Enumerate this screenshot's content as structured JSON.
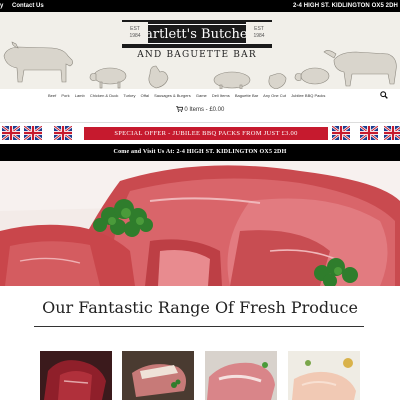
{
  "topbar": {
    "left_text": "y",
    "contact": "Contact Us",
    "address": "2-4 HIGH ST. KIDLINGTON OX5 2DH"
  },
  "logo": {
    "name": "Bartlett's Butchers",
    "subtitle": "AND BAGUETTE BAR",
    "est_label_left": "EST",
    "est_year_left": "1984",
    "est_label_right": "EST",
    "est_year_right": "1984"
  },
  "nav": {
    "items": [
      "Beef",
      "Pork",
      "Lamb",
      "Chicken & Duck",
      "Turkey",
      "Offal",
      "Sausages & Burgers",
      "Game",
      "Deli Items",
      "Baguette Bar",
      "Any One Cut",
      "Jubilee BBQ Packs"
    ],
    "search_icon": "search-icon"
  },
  "cart": {
    "icon": "cart-icon",
    "text": "0 Items - £0.00"
  },
  "offer": {
    "text": "SPECIAL OFFER - JUBILEE BBQ PACKS FROM JUST £3.00",
    "color": "#c61a2e"
  },
  "visit": {
    "text": "Come and Visit Us At: 2-4 HIGH ST. KIDLINGTON OX5 2DH"
  },
  "range": {
    "title": "Our Fantastic Range Of Fresh Produce"
  },
  "colors": {
    "header_bg": "#f1efe9",
    "bar_black": "#000000",
    "accent_red": "#c61a2e"
  }
}
